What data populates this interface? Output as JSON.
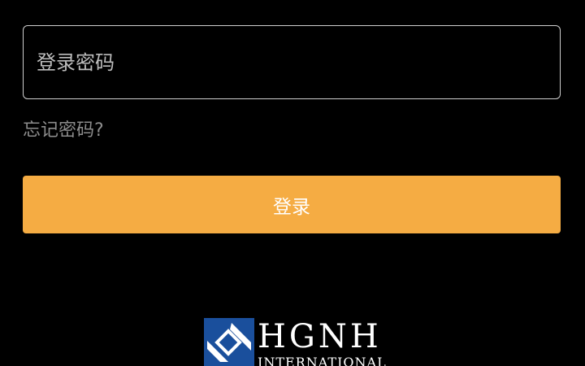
{
  "login_form": {
    "password_placeholder": "登录密码",
    "password_value": "",
    "forgot_password_label": "忘记密码?",
    "login_button_label": "登录"
  },
  "logo": {
    "name": "HGNH",
    "subtitle": "INTERNATIONAL",
    "mark_icon": "hgnh-logo-mark-icon"
  },
  "colors": {
    "background": "#000000",
    "accent": "#f5ac43",
    "logo_blue": "#1a4f9c",
    "field_border": "#cfcfcf",
    "muted_text": "#8d8d8d"
  }
}
